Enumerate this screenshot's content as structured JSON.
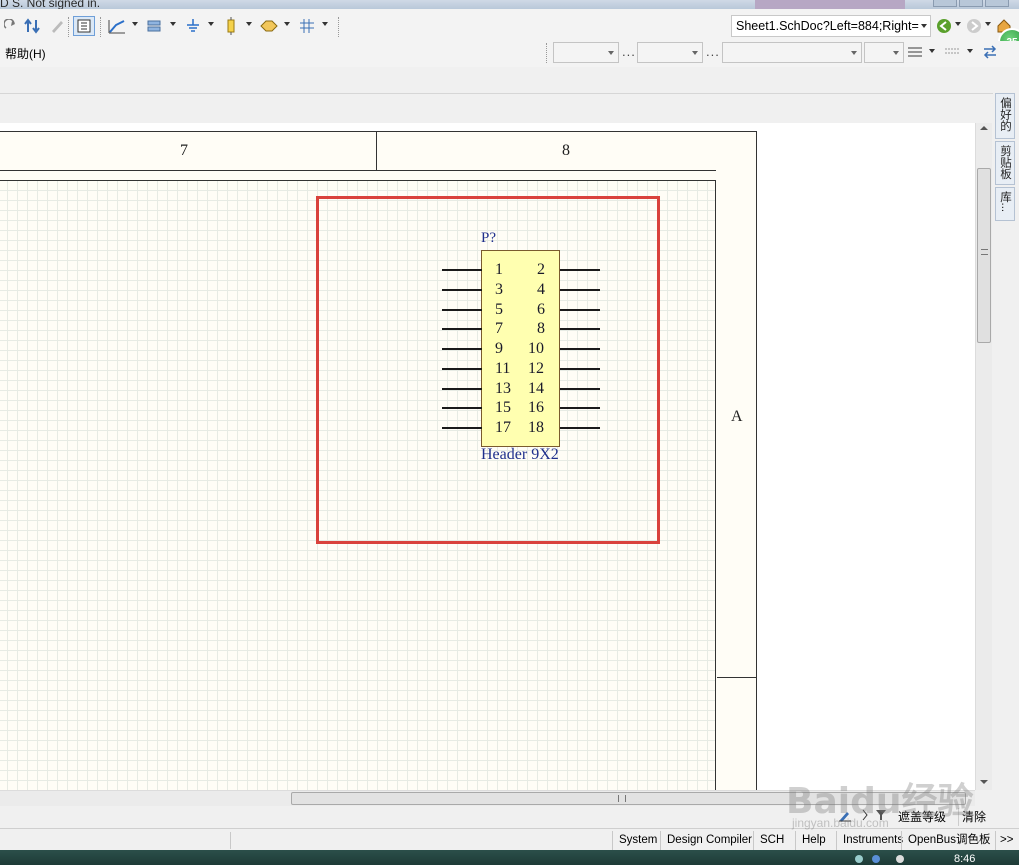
{
  "title_bar": {
    "text": "D S. Not signed in."
  },
  "toolbar": {
    "document_path": "Sheet1.SchDoc?Left=884;Right=",
    "help_menu": "帮助(H)",
    "combo_dots": "..."
  },
  "side_panels": [
    "偏好的",
    "剪贴板",
    "库..."
  ],
  "notification_badge": "35",
  "sheet": {
    "zone_columns": [
      "7",
      "8"
    ],
    "zone_row": "A"
  },
  "component": {
    "designator": "P?",
    "comment": "Header 9X2",
    "pins_left": [
      "1",
      "3",
      "5",
      "7",
      "9",
      "11",
      "13",
      "15",
      "17"
    ],
    "pins_right": [
      "2",
      "4",
      "6",
      "8",
      "10",
      "12",
      "14",
      "16",
      "18"
    ]
  },
  "filter_bar": {
    "mask_level": "遮盖等级",
    "clear": "清除"
  },
  "status_bar": {
    "panels": [
      "System",
      "Design Compiler",
      "SCH",
      "Help",
      "Instruments",
      "OpenBus调色板",
      ">>"
    ]
  },
  "taskbar": {
    "clock": "8:46"
  },
  "watermark": {
    "logo": "Baidu经验",
    "url": "jingyan.baidu.com"
  },
  "colors": {
    "highlight": "#d9423c",
    "component_fill": "#ffffb0",
    "component_text": "#1f2f8c",
    "sheet_bg": "#fffdf6"
  }
}
